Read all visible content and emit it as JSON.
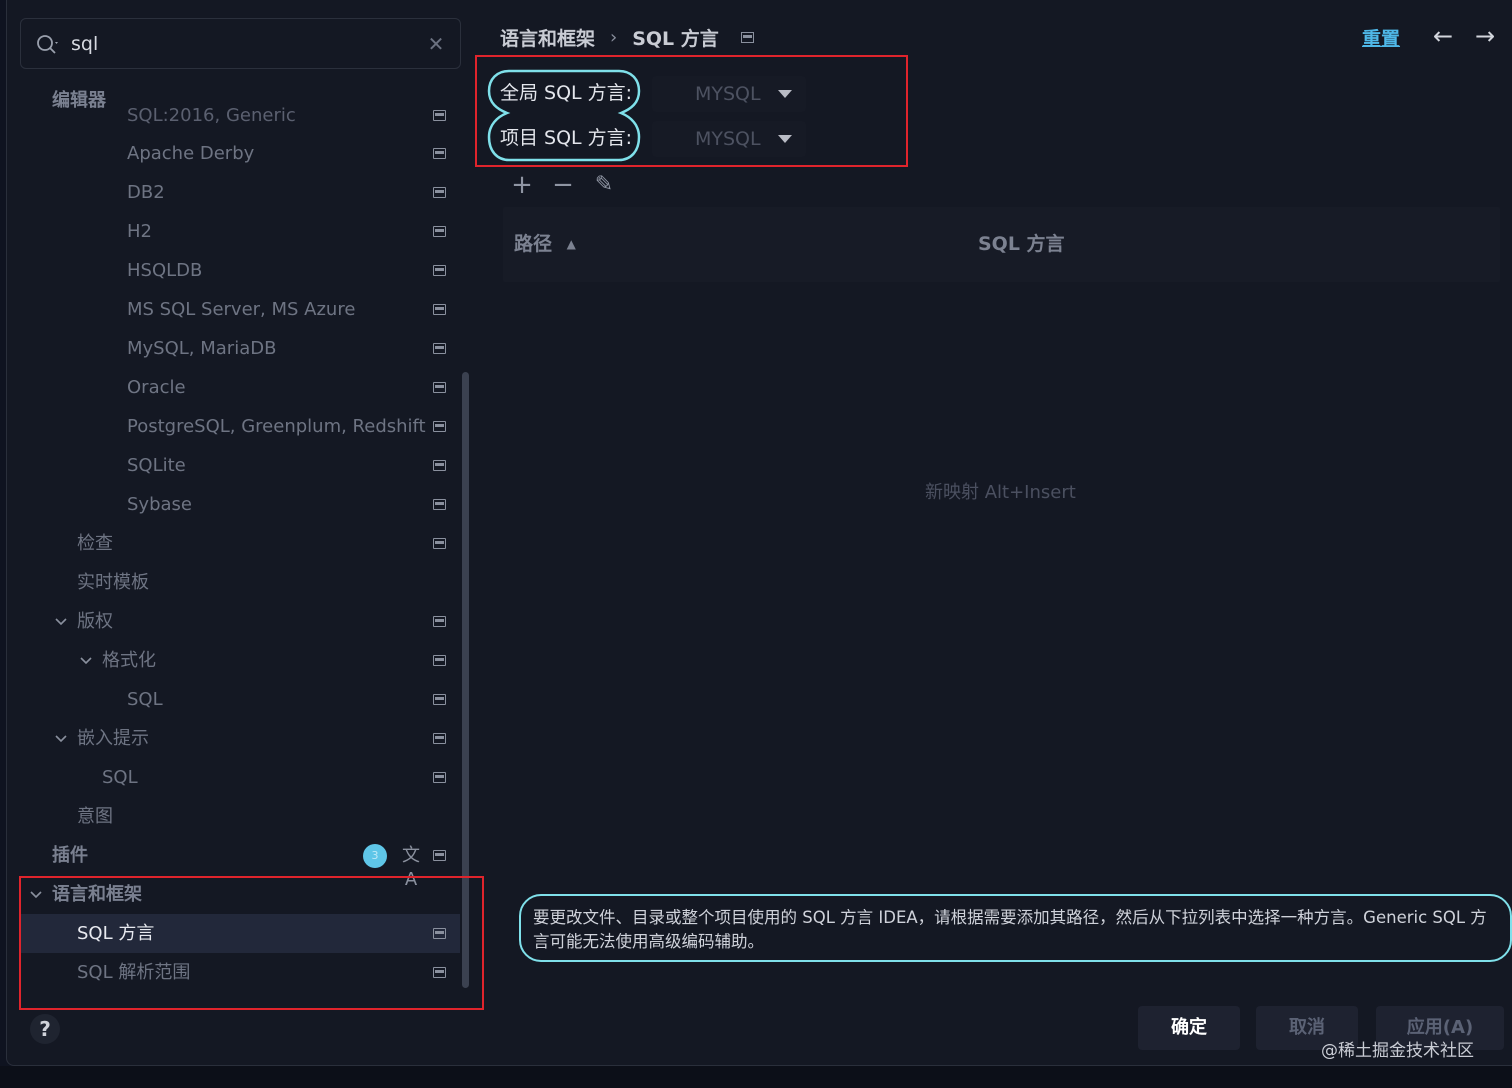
{
  "search": {
    "value": "sql",
    "clear_glyph": "✕"
  },
  "sidebar": {
    "sticky_header": "编辑器",
    "partial_item": "SQL:2016, Generic",
    "items": [
      {
        "label": "Apache Derby"
      },
      {
        "label": "DB2"
      },
      {
        "label": "H2"
      },
      {
        "label": "HSQLDB"
      },
      {
        "label": "MS SQL Server, MS Azure"
      },
      {
        "label": "MySQL, MariaDB"
      },
      {
        "label": "Oracle"
      },
      {
        "label": "PostgreSQL, Greenplum, Redshift"
      },
      {
        "label": "SQLite"
      },
      {
        "label": "Sybase"
      },
      {
        "label": "检查"
      },
      {
        "label": "实时模板"
      },
      {
        "label": "版权"
      },
      {
        "label": "格式化"
      },
      {
        "label": "SQL"
      },
      {
        "label": "嵌入提示"
      },
      {
        "label": "SQL"
      },
      {
        "label": "意图"
      },
      {
        "label": "插件"
      },
      {
        "label": "语言和框架"
      },
      {
        "label": "SQL 方言"
      },
      {
        "label": "SQL 解析范围"
      }
    ],
    "plugin_badge": "3",
    "translate_icon_glyph": "文A"
  },
  "header": {
    "breadcrumb_parent": "语言和框架",
    "breadcrumb_separator": "›",
    "breadcrumb_current": "SQL 方言",
    "reset_label": "重置",
    "back_glyph": "←",
    "forward_glyph": "→"
  },
  "dialects": {
    "global_label": "全局 SQL 方言:",
    "global_value": "MYSQL",
    "project_label": "项目 SQL 方言:",
    "project_value": "MYSQL"
  },
  "toolbar": {
    "add": "+",
    "remove": "−",
    "edit": "✎"
  },
  "table": {
    "columns": [
      "路径",
      "SQL 方言"
    ],
    "sort_indicator": "▲",
    "empty_text": "新映射 Alt+Insert"
  },
  "info_text": "要更改文件、目录或整个项目使用的 SQL 方言 IDEA，请根据需要添加其路径，然后从下拉列表中选择一种方言。Generic SQL 方言可能无法使用高级编码辅助。",
  "footer": {
    "ok_label": "确定",
    "cancel_label": "取消",
    "apply_label": "应用(A)",
    "help_glyph": "?"
  },
  "watermark": "@稀土掘金技术社区",
  "colors": {
    "accent_link": "#4fb8e8",
    "annotation_red": "#e0242c",
    "annotation_cyan": "#7fe0ea",
    "badge": "#5fc6e8"
  }
}
